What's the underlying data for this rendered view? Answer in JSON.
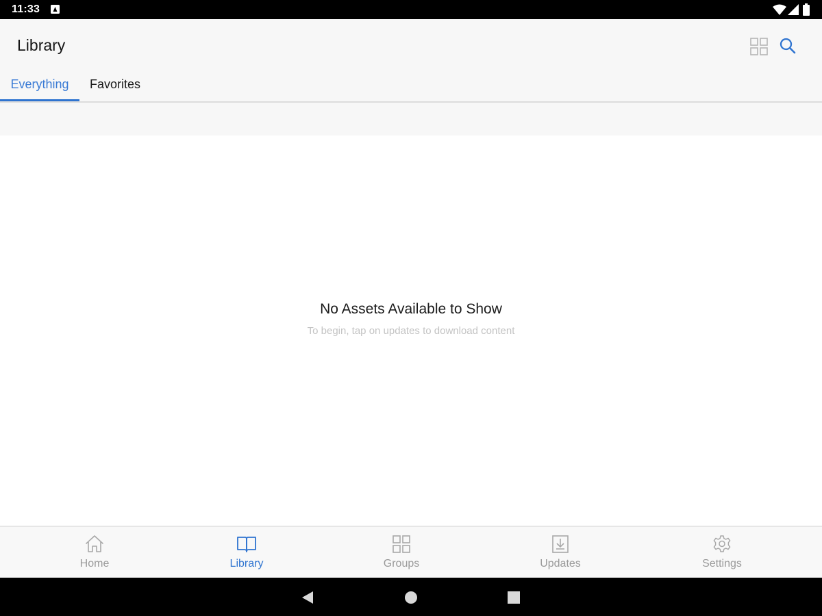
{
  "status_bar": {
    "time": "11:33",
    "icons": [
      "notification-icon",
      "wifi-icon",
      "signal-icon",
      "battery-icon"
    ]
  },
  "header": {
    "title": "Library",
    "actions": [
      "grid-view-icon",
      "search-icon"
    ]
  },
  "tabs": [
    {
      "label": "Everything",
      "active": true
    },
    {
      "label": "Favorites",
      "active": false
    }
  ],
  "empty_state": {
    "title": "No Assets Available to Show",
    "subtitle": "To begin, tap on updates to download content"
  },
  "bottom_nav": [
    {
      "label": "Home",
      "icon": "home-icon",
      "active": false
    },
    {
      "label": "Library",
      "icon": "book-icon",
      "active": true
    },
    {
      "label": "Groups",
      "icon": "groups-grid-icon",
      "active": false
    },
    {
      "label": "Updates",
      "icon": "download-icon",
      "active": false
    },
    {
      "label": "Settings",
      "icon": "gear-icon",
      "active": false
    }
  ],
  "system_nav": [
    "back-icon",
    "home-circle-icon",
    "recents-icon"
  ],
  "colors": {
    "accent": "#2f74d0",
    "inactive": "#9a9a9a",
    "header_bg": "#f7f7f7",
    "subtitle": "#c3c3c3"
  }
}
